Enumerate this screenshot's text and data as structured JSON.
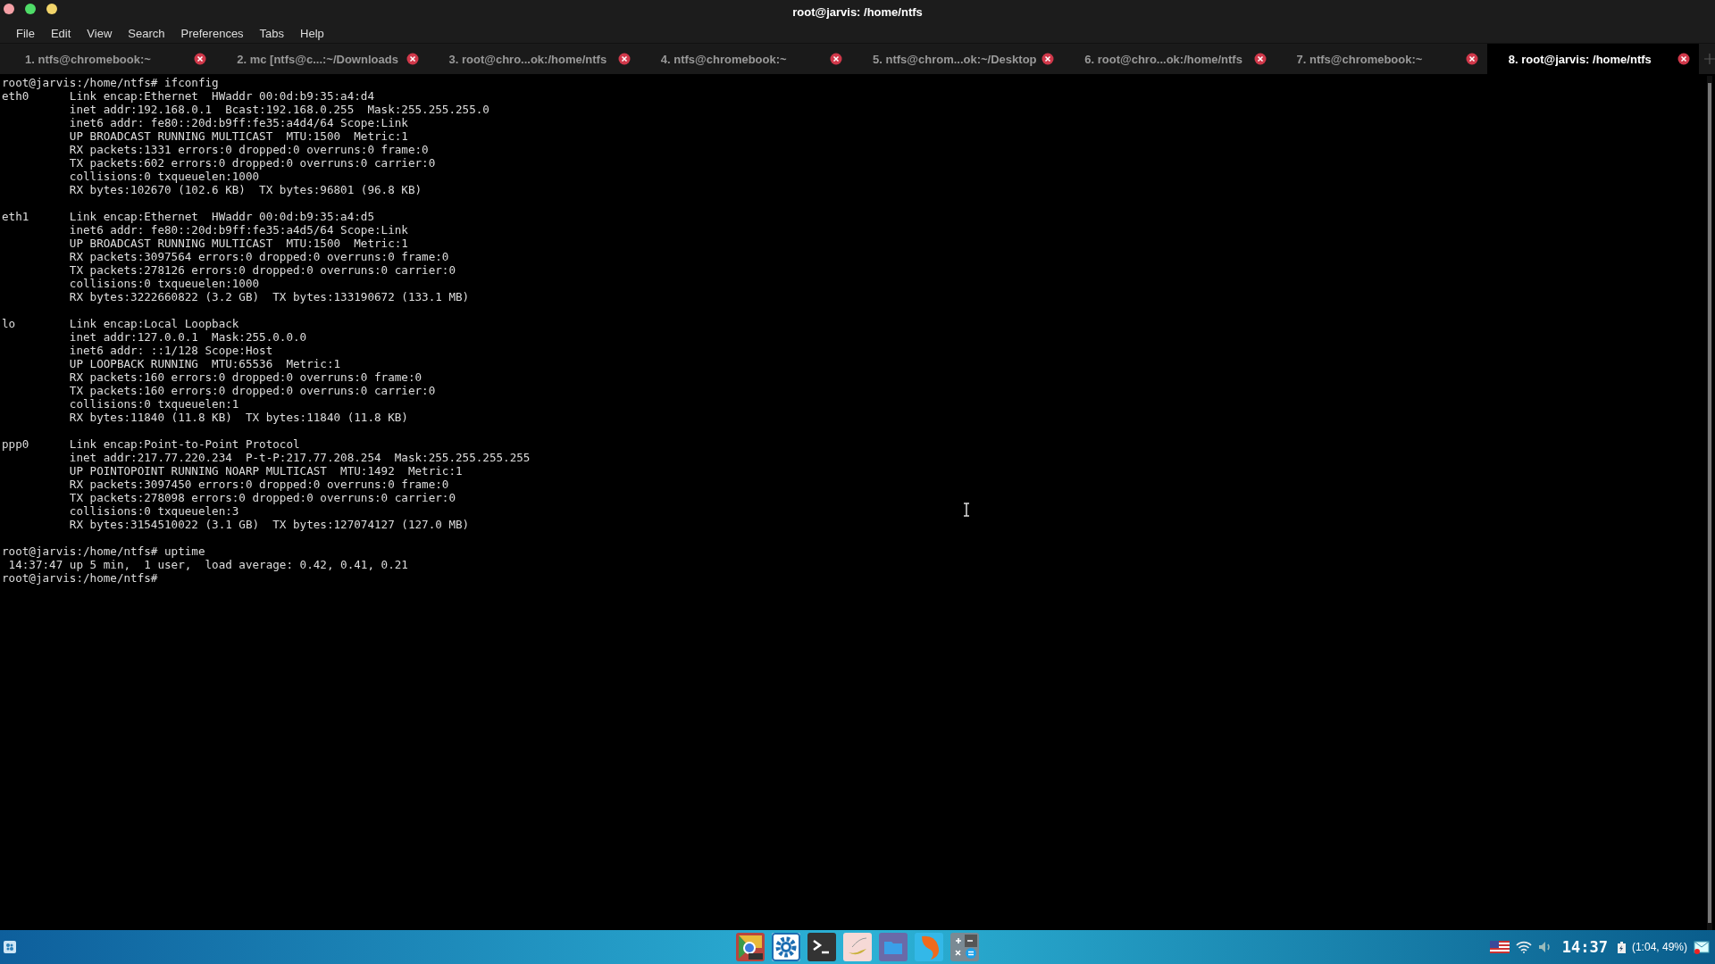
{
  "window": {
    "title": "root@jarvis: /home/ntfs"
  },
  "menu": [
    "File",
    "Edit",
    "View",
    "Search",
    "Preferences",
    "Tabs",
    "Help"
  ],
  "tabs": [
    {
      "label": "1. ntfs@chromebook:~",
      "selected": false
    },
    {
      "label": "2. mc [ntfs@c...:~/Downloads",
      "selected": false
    },
    {
      "label": "3. root@chro...ok:/home/ntfs",
      "selected": false
    },
    {
      "label": "4. ntfs@chromebook:~",
      "selected": false
    },
    {
      "label": "5. ntfs@chrom...ok:~/Desktop",
      "selected": false
    },
    {
      "label": "6. root@chro...ok:/home/ntfs",
      "selected": false
    },
    {
      "label": "7. ntfs@chromebook:~",
      "selected": false
    },
    {
      "label": "8. root@jarvis: /home/ntfs",
      "selected": true
    }
  ],
  "terminal": {
    "blocks": [
      {
        "lines": [
          "root@jarvis:/home/ntfs# ifconfig",
          "eth0      Link encap:Ethernet  HWaddr 00:0d:b9:35:a4:d4  ",
          "          inet addr:192.168.0.1  Bcast:192.168.0.255  Mask:255.255.255.0",
          "          inet6 addr: fe80::20d:b9ff:fe35:a4d4/64 Scope:Link",
          "          UP BROADCAST RUNNING MULTICAST  MTU:1500  Metric:1",
          "          RX packets:1331 errors:0 dropped:0 overruns:0 frame:0",
          "          TX packets:602 errors:0 dropped:0 overruns:0 carrier:0",
          "          collisions:0 txqueuelen:1000 ",
          "          RX bytes:102670 (102.6 KB)  TX bytes:96801 (96.8 KB)"
        ]
      },
      {
        "lines": [
          "eth1      Link encap:Ethernet  HWaddr 00:0d:b9:35:a4:d5  ",
          "          inet6 addr: fe80::20d:b9ff:fe35:a4d5/64 Scope:Link",
          "          UP BROADCAST RUNNING MULTICAST  MTU:1500  Metric:1",
          "          RX packets:3097564 errors:0 dropped:0 overruns:0 frame:0",
          "          TX packets:278126 errors:0 dropped:0 overruns:0 carrier:0",
          "          collisions:0 txqueuelen:1000 ",
          "          RX bytes:3222660822 (3.2 GB)  TX bytes:133190672 (133.1 MB)"
        ]
      },
      {
        "lines": [
          "lo        Link encap:Local Loopback  ",
          "          inet addr:127.0.0.1  Mask:255.0.0.0",
          "          inet6 addr: ::1/128 Scope:Host",
          "          UP LOOPBACK RUNNING  MTU:65536  Metric:1",
          "          RX packets:160 errors:0 dropped:0 overruns:0 frame:0",
          "          TX packets:160 errors:0 dropped:0 overruns:0 carrier:0",
          "          collisions:0 txqueuelen:1 ",
          "          RX bytes:11840 (11.8 KB)  TX bytes:11840 (11.8 KB)"
        ]
      },
      {
        "lines": [
          "ppp0      Link encap:Point-to-Point Protocol  ",
          "          inet addr:217.77.220.234  P-t-P:217.77.208.254  Mask:255.255.255.255",
          "          UP POINTOPOINT RUNNING NOARP MULTICAST  MTU:1492  Metric:1",
          "          RX packets:3097450 errors:0 dropped:0 overruns:0 frame:0",
          "          TX packets:278098 errors:0 dropped:0 overruns:0 carrier:0",
          "          collisions:0 txqueuelen:3 ",
          "          RX bytes:3154510022 (3.1 GB)  TX bytes:127074127 (127.0 MB)"
        ]
      },
      {
        "lines": [
          "root@jarvis:/home/ntfs# uptime",
          " 14:37:47 up 5 min,  1 user,  load average: 0.42, 0.41, 0.21",
          "root@jarvis:/home/ntfs# "
        ]
      }
    ]
  },
  "taskbar": {
    "clock": "14:37",
    "battery": "(1:04, 49%)"
  }
}
